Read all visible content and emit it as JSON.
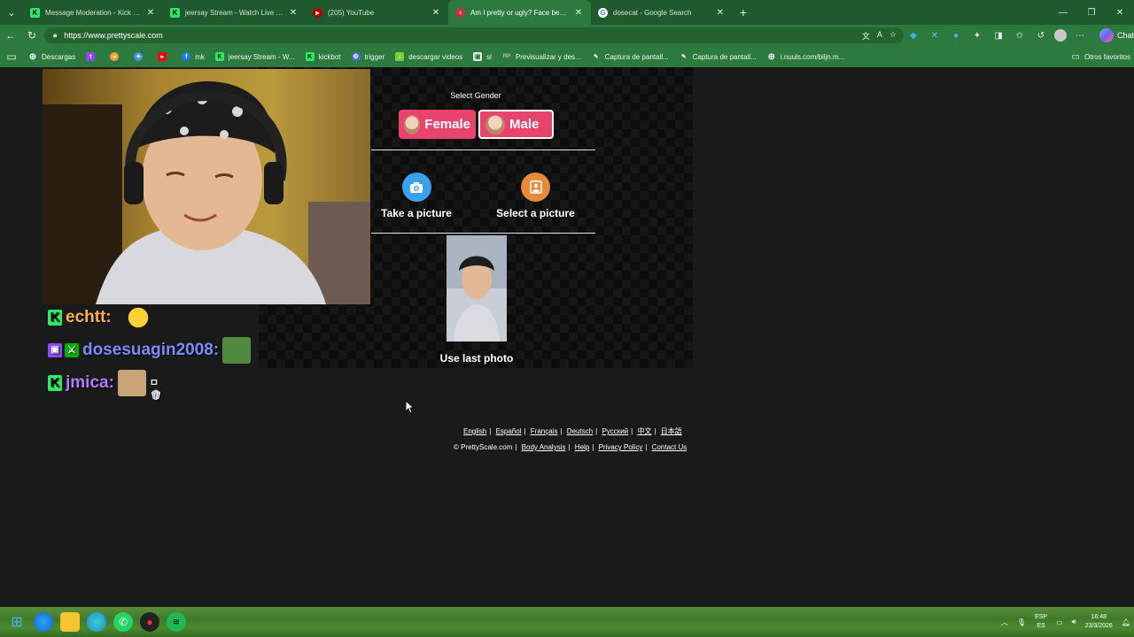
{
  "tabs": [
    {
      "title": "Message Moderation - Kick Dash",
      "favicon": "kick-icon",
      "active": false
    },
    {
      "title": "jeersay Stream - Watch Live on Ki",
      "favicon": "kick-icon",
      "active": false
    },
    {
      "title": "(205) YouTube",
      "favicon": "youtube-icon",
      "active": false
    },
    {
      "title": "Am I pretty or ugly? Face beauty a",
      "favicon": "prettyscale-icon",
      "active": true
    },
    {
      "title": "dosecat - Google Search",
      "favicon": "google-icon",
      "active": false
    }
  ],
  "address": {
    "url": "https://www.prettyscale.com"
  },
  "copilot_label": "Chat",
  "bookmarks": [
    {
      "label": "Descargas",
      "icon": "globe-icon",
      "color": "#dfe"
    },
    {
      "label": "",
      "icon": "twitch-icon",
      "color": "#9146ff"
    },
    {
      "label": "",
      "icon": "duck-icon",
      "color": "#f0a030"
    },
    {
      "label": "",
      "icon": "puzzle-icon",
      "color": "#4a90e2"
    },
    {
      "label": "",
      "icon": "youtube-icon",
      "color": "#ff0000"
    },
    {
      "label": "mk",
      "icon": "facebook-icon",
      "color": "#1877f2"
    },
    {
      "label": "jeersay Stream - W...",
      "icon": "kick-icon",
      "color": "#2ee866"
    },
    {
      "label": "kickbot",
      "icon": "kick-icon",
      "color": "#2ee866"
    },
    {
      "label": "trigger",
      "icon": "gear-icon",
      "color": "#4a6ee0"
    },
    {
      "label": "descargar videos",
      "icon": "download-icon",
      "color": "#7ccf3a"
    },
    {
      "label": "sl",
      "icon": "sl-icon",
      "color": "#e8e8e8"
    },
    {
      "label": "Previsualizar y des...",
      "icon": "rp-icon",
      "color": "#c0c0c0"
    },
    {
      "label": "Captura de pantall...",
      "icon": "pen-icon",
      "color": "#e8e8e8"
    },
    {
      "label": "Captura de pantall...",
      "icon": "pen-icon",
      "color": "#e8e8e8"
    },
    {
      "label": "i.nuuls.com/biljn.m...",
      "icon": "globe-icon",
      "color": "#e8e8e8"
    }
  ],
  "bookmarks_other": "Otros favoritos",
  "chat": [
    {
      "user": "echtt:",
      "platform": "kick",
      "color": "#ffb347",
      "emote": "smile"
    },
    {
      "user": "dosesuagin2008:",
      "platform": "twitch",
      "color": "#7b8cff",
      "emote": "pepe"
    },
    {
      "user": "jmica:",
      "platform": "kick",
      "color": "#b57aff",
      "emote": "cat"
    }
  ],
  "gender": {
    "label": "Select Gender",
    "female": "Female",
    "male": "Male"
  },
  "actions": {
    "take": "Take a picture",
    "select": "Select a picture",
    "last": "Use last photo"
  },
  "languages": [
    "English",
    "Español",
    "Français",
    "Deutsch",
    "Русский",
    "中文",
    "日本語"
  ],
  "footer": {
    "copyright": "© PrettyScale.com",
    "links": [
      "Body Analysis",
      "Help",
      "Privacy Policy",
      "Contact Us"
    ]
  },
  "tray": {
    "lang_top": "ESP",
    "lang_bottom": "ES",
    "time": "16:48",
    "date": "23/3/2026"
  },
  "colors": {
    "accent_pink": "#e8456e",
    "chrome_green": "#2d7a3e",
    "camera_blue": "#3aa0f0",
    "gallery_orange": "#e88a3a"
  }
}
